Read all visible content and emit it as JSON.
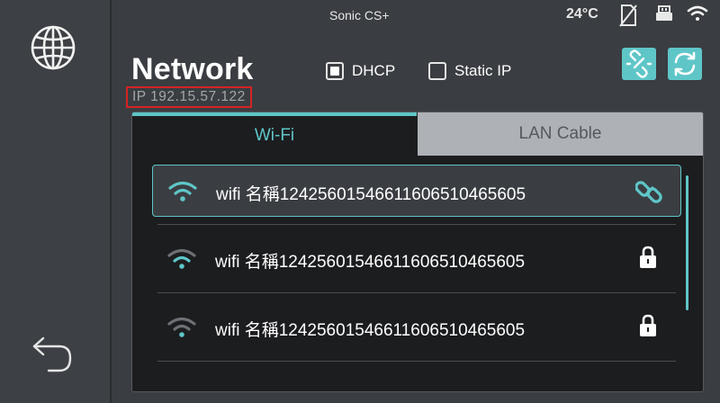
{
  "status_bar": {
    "device_name": "Sonic CS+",
    "temperature": "24°C",
    "icons": [
      "storage-off-icon",
      "usb-drive-icon",
      "wifi-status-icon"
    ]
  },
  "sidebar": {
    "top_icon": "globe-icon",
    "bottom_icon": "back-arrow-icon"
  },
  "page": {
    "title": "Network",
    "ip_text": "IP 192.15.57.122"
  },
  "options": {
    "dhcp_label": "DHCP",
    "dhcp_checked": true,
    "static_label": "Static IP",
    "static_checked": false
  },
  "toolbar": {
    "buttons": [
      "disconnect-link-icon",
      "refresh-icon"
    ]
  },
  "tabs": [
    {
      "label": "Wi-Fi",
      "active": true
    },
    {
      "label": "LAN Cable",
      "active": false
    }
  ],
  "networks": [
    {
      "ssid": "wifi 名稱1242560154661160651046560​5",
      "status": "connected",
      "trailing_icon": "link-icon"
    },
    {
      "ssid": "wifi 名稱12425601546611606510465605",
      "status": "locked",
      "trailing_icon": "lock-icon"
    },
    {
      "ssid": "wifi 名稱12425601546611606510465605",
      "status": "locked",
      "trailing_icon": "lock-icon"
    }
  ],
  "colors": {
    "accent": "#5fc6c8",
    "background": "#3a3d41",
    "panel": "#1c1d1f",
    "highlight_border": "#d42424"
  }
}
